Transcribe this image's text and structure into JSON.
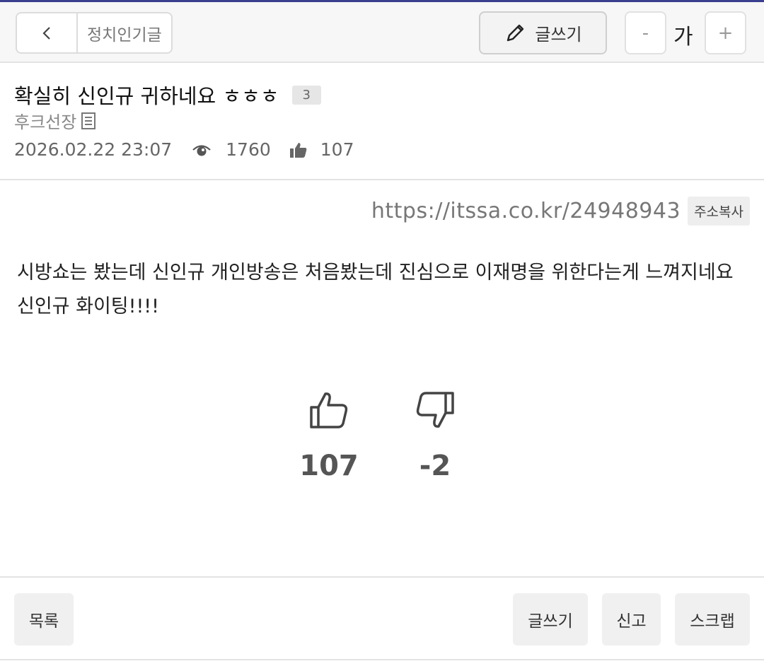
{
  "topbar": {
    "board_name": "정치인기글",
    "write_label": "글쓰기",
    "font_minus": "-",
    "font_size_label": "가",
    "font_plus": "+"
  },
  "post": {
    "title": "확실히 신인규 귀하네요 ㅎㅎㅎ",
    "comment_count": "3",
    "author": "후크선장",
    "date": "2026.02.22 23:07",
    "views": "1760",
    "likes": "107",
    "url": "https://itssa.co.kr/24948943",
    "copy_label": "주소복사",
    "body": "시방쇼는 봤는데 신인규 개인방송은 처음봤는데 진심으로 이재명을 위한다는게 느껴지네요 신인규 화이팅!!!!"
  },
  "votes": {
    "up": "107",
    "down": "-2"
  },
  "bottom": {
    "list_label": "목록",
    "write_label": "글쓰기",
    "report_label": "신고",
    "scrap_label": "스크랩"
  },
  "colors": {
    "accent_line": "#3b3f8f",
    "vote_text": "#555555"
  }
}
